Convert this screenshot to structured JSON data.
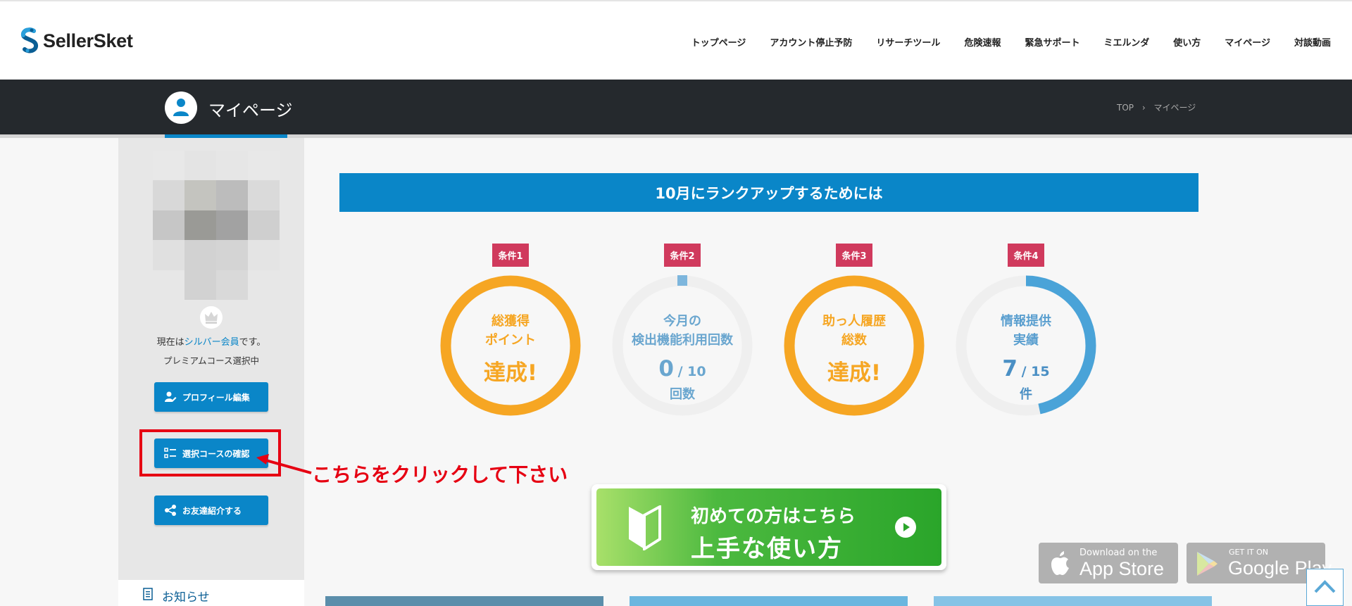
{
  "header": {
    "logo_text": "SellerSket",
    "nav": [
      "トップページ",
      "アカウント停止予防",
      "リサーチツール",
      "危険速報",
      "緊急サポート",
      "ミエルンダ",
      "使い方",
      "マイページ",
      "対談動画"
    ]
  },
  "titlebar": {
    "title": "マイページ",
    "breadcrumb": [
      "TOP",
      "›",
      "マイページ"
    ]
  },
  "sidebar": {
    "member_prefix": "現在は",
    "member_rank": "シルバー会員",
    "member_suffix": "です。",
    "course_status": "プレミアムコース選択中",
    "buttons": [
      "プロフィール編集",
      "選択コースの確認",
      "お友達紹介する"
    ],
    "notice_label": "お知らせ"
  },
  "annotation": {
    "text": "こちらをクリックして下さい"
  },
  "rankup": {
    "banner": "10月にランクアップするためには",
    "conditions": [
      {
        "tag": "条件1",
        "label_lines": [
          "総獲得",
          "ポイント"
        ],
        "result": "達成!",
        "progress": 1.0
      },
      {
        "tag": "条件2",
        "label_lines": [
          "今月の",
          "検出機能利用回数"
        ],
        "current": "0",
        "total": "/ 10",
        "unit": "回数",
        "progress": 0.0
      },
      {
        "tag": "条件3",
        "label_lines": [
          "助っ人履歴",
          "総数"
        ],
        "result": "達成!",
        "progress": 1.0
      },
      {
        "tag": "条件4",
        "label_lines": [
          "情報提供",
          "実績"
        ],
        "current": "7",
        "total": "/ 15",
        "unit": "件",
        "progress": 0.4667
      }
    ]
  },
  "cta": {
    "line1": "初めての方はこちら",
    "line2": "上手な使い方"
  },
  "stores": {
    "apple_small": "Download on the",
    "apple_big": "App Store",
    "google_small": "GET IT ON",
    "google_big": "Google Play"
  },
  "colors": {
    "accent_blue": "#0a86c8",
    "achieved_orange": "#f6a623",
    "tag_red": "#d03a5d",
    "annotation_red": "#e60012",
    "progress_blue": "#4aa3d8"
  }
}
